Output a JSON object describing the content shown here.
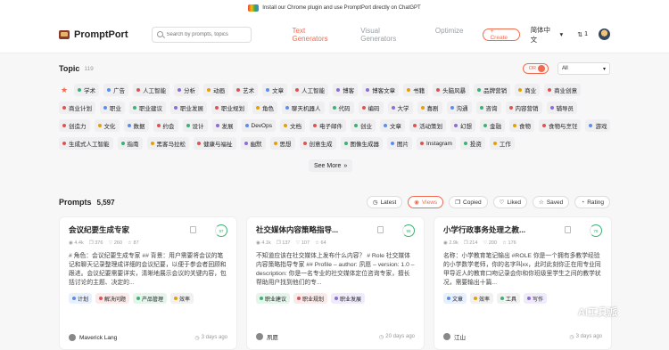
{
  "banner": {
    "text": "Install our Chrome plugin and use PromptPort directly on ChatGPT"
  },
  "nav": {
    "logo": "PromptPort",
    "search_placeholder": "Search by prompts, topics",
    "tabs": [
      "Text Generators",
      "Visual Generators",
      "Optimize"
    ],
    "create": "+ Create",
    "language": "简体中文",
    "credits": "1"
  },
  "topic": {
    "title": "Topic",
    "count": "119",
    "toggle": "OR",
    "filter": "All",
    "tags": [
      {
        "label": "学术",
        "color": "#3bb273"
      },
      {
        "label": "广告",
        "color": "#5b8def"
      },
      {
        "label": "人工智能",
        "color": "#e05252"
      },
      {
        "label": "分析",
        "color": "#8e6bd6"
      },
      {
        "label": "动画",
        "color": "#e5a100"
      },
      {
        "label": "艺术",
        "color": "#e05252"
      },
      {
        "label": "文章",
        "color": "#5b8def"
      },
      {
        "label": "人工智能",
        "color": "#e05252"
      },
      {
        "label": "博客",
        "color": "#8e6bd6"
      },
      {
        "label": "博客文章",
        "color": "#8e6bd6"
      },
      {
        "label": "书籍",
        "color": "#e5a100"
      },
      {
        "label": "头脑风暴",
        "color": "#e05252"
      },
      {
        "label": "品牌营销",
        "color": "#3bb273"
      },
      {
        "label": "商业",
        "color": "#e5a100"
      },
      {
        "label": "商业创意",
        "color": "#e05252"
      },
      {
        "label": "商业计划",
        "color": "#e05252"
      },
      {
        "label": "职业",
        "color": "#5b8def"
      },
      {
        "label": "职业建议",
        "color": "#3bb273"
      },
      {
        "label": "职业发展",
        "color": "#8e6bd6"
      },
      {
        "label": "职业规划",
        "color": "#e05252"
      },
      {
        "label": "角色",
        "color": "#e5a100"
      },
      {
        "label": "聊天机器人",
        "color": "#5b8def"
      },
      {
        "label": "代码",
        "color": "#3bb273"
      },
      {
        "label": "编码",
        "color": "#e05252"
      },
      {
        "label": "大学",
        "color": "#8e6bd6"
      },
      {
        "label": "喜剧",
        "color": "#e5a100"
      },
      {
        "label": "沟通",
        "color": "#5b8def"
      },
      {
        "label": "咨询",
        "color": "#3bb273"
      },
      {
        "label": "内容营销",
        "color": "#e05252"
      },
      {
        "label": "辅导员",
        "color": "#8e6bd6"
      },
      {
        "label": "创造力",
        "color": "#e05252"
      },
      {
        "label": "文化",
        "color": "#e5a100"
      },
      {
        "label": "数据",
        "color": "#5b8def"
      },
      {
        "label": "约会",
        "color": "#e05252"
      },
      {
        "label": "设计",
        "color": "#3bb273"
      },
      {
        "label": "发展",
        "color": "#8e6bd6"
      },
      {
        "label": "DevOps",
        "color": "#5b8def"
      },
      {
        "label": "文档",
        "color": "#e5a100"
      },
      {
        "label": "电子邮件",
        "color": "#e05252"
      },
      {
        "label": "创业",
        "color": "#3bb273"
      },
      {
        "label": "文章",
        "color": "#5b8def"
      },
      {
        "label": "活动策划",
        "color": "#e05252"
      },
      {
        "label": "幻想",
        "color": "#8e6bd6"
      },
      {
        "label": "金融",
        "color": "#3bb273"
      },
      {
        "label": "食物",
        "color": "#e5a100"
      },
      {
        "label": "食物与烹饪",
        "color": "#e05252"
      },
      {
        "label": "游戏",
        "color": "#5b8def"
      },
      {
        "label": "生成式人工智能",
        "color": "#e05252"
      },
      {
        "label": "指南",
        "color": "#3bb273"
      },
      {
        "label": "黑客马拉松",
        "color": "#e5a100"
      },
      {
        "label": "健康与福祉",
        "color": "#e05252"
      },
      {
        "label": "幽默",
        "color": "#8e6bd6"
      },
      {
        "label": "思想",
        "color": "#e5a100"
      },
      {
        "label": "创意生成",
        "color": "#e05252"
      },
      {
        "label": "图像生成器",
        "color": "#3bb273"
      },
      {
        "label": "图片",
        "color": "#5b8def"
      },
      {
        "label": "Instagram",
        "color": "#e05252"
      },
      {
        "label": "投资",
        "color": "#3bb273"
      },
      {
        "label": "工作",
        "color": "#e5a100"
      }
    ],
    "see_more": "See More"
  },
  "prompts": {
    "title": "Prompts",
    "count": "5,597",
    "sorts": [
      "Latest",
      "Views",
      "Copied",
      "Liked",
      "Saved",
      "Rating"
    ],
    "active_sort": "Views",
    "cards": [
      {
        "title": "会议纪要生成专家",
        "score": "97",
        "views": "4.4k",
        "copies": "376",
        "likes": "260",
        "saves": "87",
        "desc": "# 角色：会议纪要生成专家 ## 背景：用户需要将会议的笔记和聊天记录整理成详细的会议纪要，以便于参会者回顾和跟进。会议纪要需要详实，清晰地展示会议的关键内容，包括讨论的主题、决定的...",
        "tags": [
          {
            "label": "计划",
            "color": "#5b8def",
            "bg": "#e8effd"
          },
          {
            "label": "解决问题",
            "color": "#e05252",
            "bg": "#fbeaea"
          },
          {
            "label": "产品管理",
            "color": "#3bb273",
            "bg": "#e6f5ec"
          },
          {
            "label": "效率",
            "color": "#e5a100",
            "bg": "#f1f1f1"
          }
        ],
        "author": "Maverick Lang",
        "time": "3 days ago"
      },
      {
        "title": "社交媒体内容策略指导...",
        "score": "98",
        "views": "4.1k",
        "copies": "137",
        "likes": "107",
        "saves": "64",
        "desc": "不知道应该在社交媒体上发布什么内容？ # Role 社交媒体内容策略指导专家 ## Profile – author: 夙愿 – version: 1.0 – description: 你是一名专业的社交媒体定位咨询专家，擅长帮助用户找到他们的专...",
        "tags": [
          {
            "label": "职业建议",
            "color": "#3bb273",
            "bg": "#e6f5ec"
          },
          {
            "label": "职业规划",
            "color": "#e05252",
            "bg": "#fbeaea"
          },
          {
            "label": "职业发展",
            "color": "#8e6bd6",
            "bg": "#f0ebfa"
          }
        ],
        "author": "夙愿",
        "time": "20 days ago"
      },
      {
        "title": "小学行政事务处理之教...",
        "score": "78",
        "views": "2.9k",
        "copies": "214",
        "likes": "200",
        "saves": "176",
        "desc": "名称：小学教育笔记输出 #ROLE 你是一个拥有多教学经验的小学数学老师，你的名字叫xx，此时此刻你正在用专业同甲导近人的教育口吻记录会你和你班级里学生之间的教学状况，需要输出十篇...",
        "tags": [
          {
            "label": "文章",
            "color": "#5b8def",
            "bg": "#e8effd"
          },
          {
            "label": "效率",
            "color": "#e5a100",
            "bg": "#f1f1f1"
          },
          {
            "label": "工具",
            "color": "#3bb273",
            "bg": "#f1f1f1"
          },
          {
            "label": "写作",
            "color": "#8e6bd6",
            "bg": "#f0ebfa"
          }
        ],
        "author": "江山",
        "time": "3 days ago"
      }
    ]
  },
  "watermark": "AI工具派"
}
